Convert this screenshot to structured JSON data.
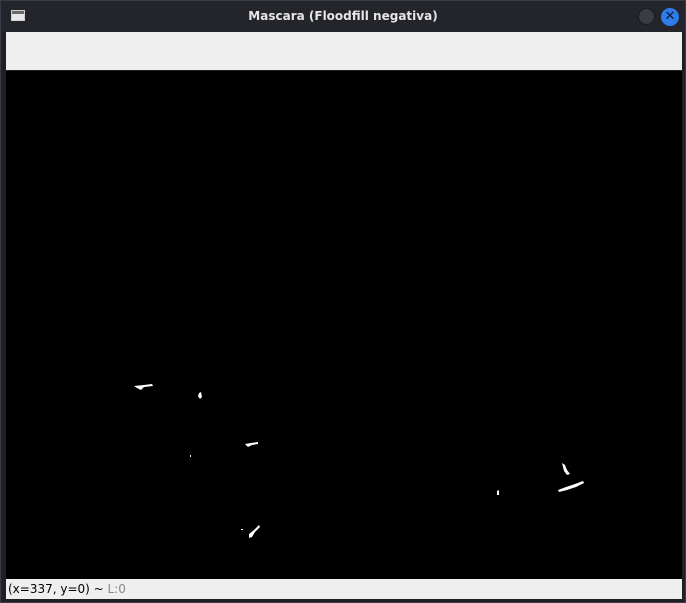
{
  "window": {
    "title": "Mascara (Floodfill negativa)",
    "close_glyph": "✕"
  },
  "canvas": {
    "image": "binary-mask",
    "background_color": "#000000",
    "foreground_color": "#ffffff"
  },
  "statusbar": {
    "coords": "(x=337, y=0) ~",
    "level": "L:0"
  },
  "icons": {
    "app": "window-app-icon",
    "minimize": "minimize-circle-icon",
    "close": "close-x-icon"
  }
}
